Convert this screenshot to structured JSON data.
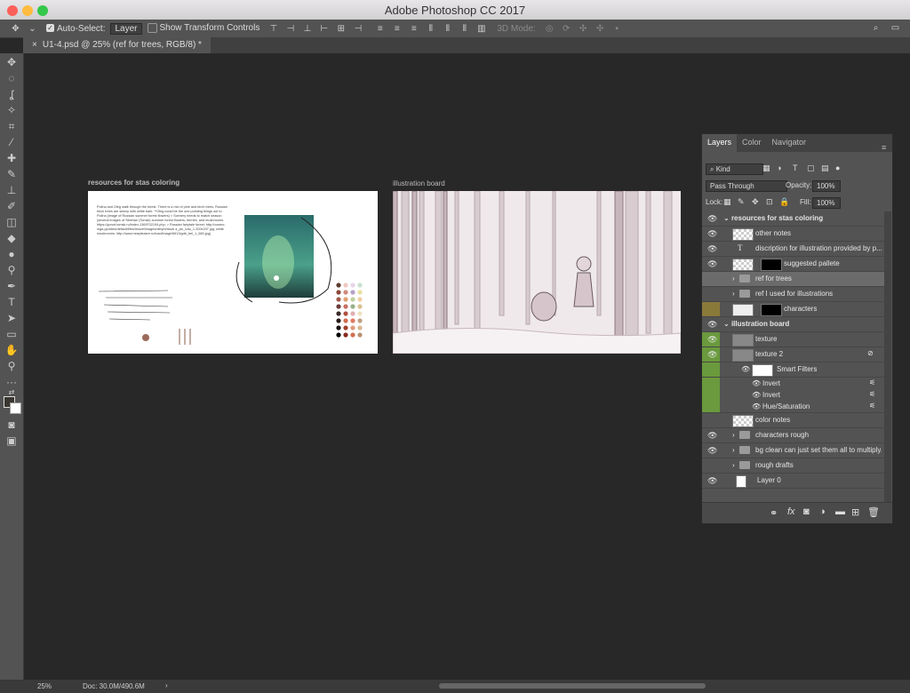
{
  "window": {
    "title": "Adobe Photoshop CC 2017"
  },
  "options": {
    "auto_select_label": "Auto-Select:",
    "auto_select_value": "Layer",
    "transform_label": "Show Transform Controls",
    "mode_3d": "3D Mode:"
  },
  "document": {
    "tab_title": "U1-4.psd @ 25% (ref for trees, RGB/8) *"
  },
  "canvas": {
    "board1_title": "resources for stas coloring",
    "board2_title": "illustration board",
    "board1_text": "Polina and Oleg walk through the forest. There is a mix of pine and birch trees. Russian birch trees are skinny with white bark. **Oleg could be the one pointing things out to Polina (image of Russian summer forest flowers) > Scenery needs to match season (several images of Siberian (Tomsk) summer forest flowers, berries, and mushrooms. https://gorod.tomsk.ru/index-1369702194.php; > Russian fairytale forest: http://cosmo-mga.pp/sites/default/files/resize/images/detym/doub a_pic_toto_1-320x207.jpg; white mushrooms: http://www.newpleasre.ru/load/image/6613/gdb_bel_1_680.jpg)"
  },
  "status": {
    "zoom": "25%",
    "doc": "Doc: 30.0M/490.6M"
  },
  "panel": {
    "tabs": [
      "Layers",
      "Color",
      "Navigator"
    ],
    "kind": "Kind",
    "blend_mode": "Pass Through",
    "opacity_label": "Opacity:",
    "opacity_value": "100%",
    "lock_label": "Lock:",
    "fill_label": "Fill:",
    "fill_value": "100%",
    "layers": [
      {
        "name": "resources for stas coloring"
      },
      {
        "name": "other notes"
      },
      {
        "name": "discription for illustration provided by p..."
      },
      {
        "name": "suggested pallete"
      },
      {
        "name": "ref for trees"
      },
      {
        "name": "ref I used for illustrations"
      },
      {
        "name": "characters"
      },
      {
        "name": "illustration board"
      },
      {
        "name": "texture"
      },
      {
        "name": "texture 2"
      },
      {
        "name": "Smart Filters"
      },
      {
        "name": "Invert"
      },
      {
        "name": "Invert"
      },
      {
        "name": "Hue/Saturation"
      },
      {
        "name": "color notes"
      },
      {
        "name": "characters rough"
      },
      {
        "name": "bg clean can just set them all to multiply..."
      },
      {
        "name": "rough drafts"
      },
      {
        "name": "Layer 0"
      }
    ]
  }
}
